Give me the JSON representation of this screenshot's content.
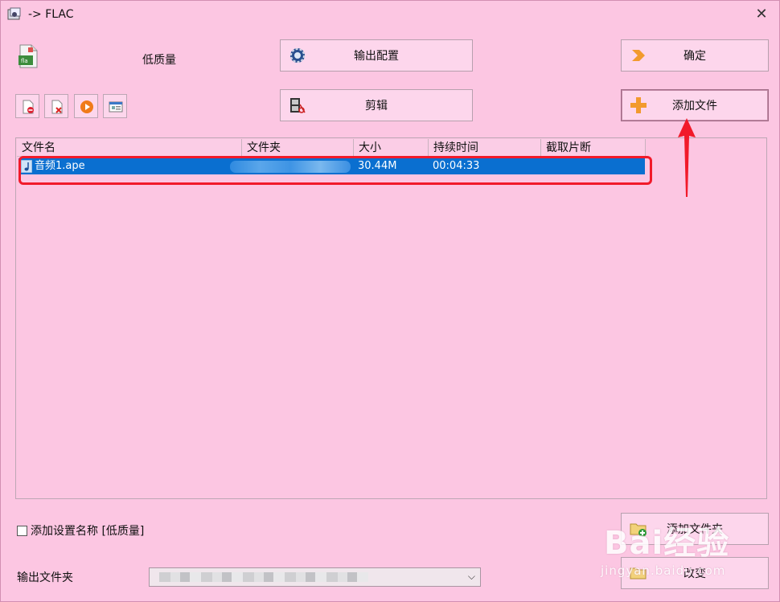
{
  "window": {
    "title": "-> FLAC"
  },
  "profile": {
    "quality_label": "低质量"
  },
  "buttons": {
    "output_config": "输出配置",
    "ok": "确定",
    "edit": "剪辑",
    "add_file": "添加文件",
    "add_folder": "添加文件夹",
    "change": "改变"
  },
  "table": {
    "columns": [
      "文件名",
      "文件夹",
      "大小",
      "持续时间",
      "截取片断"
    ],
    "rows": [
      {
        "name": "音频1.ape",
        "folder": "",
        "size": "30.44M",
        "duration": "00:04:33",
        "clip": ""
      }
    ]
  },
  "options": {
    "add_setting_name": "添加设置名称 [低质量]"
  },
  "output": {
    "label": "输出文件夹",
    "value": ""
  },
  "watermark": {
    "main": "Bai经验",
    "sub": "jingyan.baidu.com"
  },
  "icons": [
    "app-icon",
    "flac-file-icon",
    "gear-icon",
    "arrow-right-icon",
    "film-scissors-icon",
    "plus-icon",
    "remove-file-icon",
    "delete-file-icon",
    "play-icon",
    "info-icon",
    "music-note-icon",
    "folder-add-icon",
    "folder-icon",
    "chevron-down-icon",
    "close-icon"
  ],
  "colors": {
    "background": "#fcc6e2",
    "selection": "#0a6fd0",
    "highlight": "#f11a2a",
    "button": "#fdd6ec"
  }
}
